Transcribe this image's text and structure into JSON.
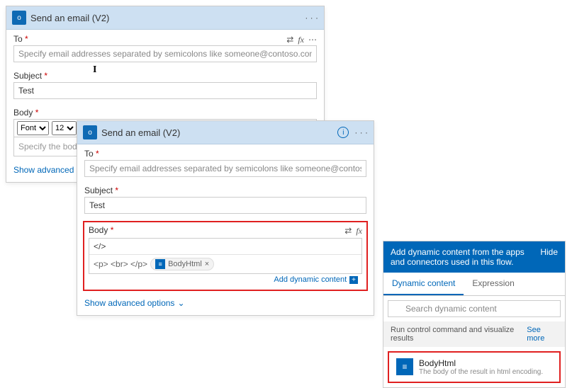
{
  "card1": {
    "title": "Send an email (V2)",
    "to_label": "To",
    "to_placeholder": "Specify email addresses separated by semicolons like someone@contoso.com",
    "subject_label": "Subject",
    "subject_value": "Test",
    "body_label": "Body",
    "font_button": "Font",
    "font_size": "12",
    "body_placeholder": "Specify the body of the",
    "advanced": "Show advanced options"
  },
  "card2": {
    "title": "Send an email (V2)",
    "to_label": "To",
    "to_placeholder": "Specify email addresses separated by semicolons like someone@contoso.com",
    "subject_label": "Subject",
    "subject_value": "Test",
    "body_label": "Body",
    "body_tagpreview": "</>",
    "body_tokens_prefix": "<p> <br> </p>",
    "body_token": "BodyHtml",
    "add_dc": "Add dynamic content",
    "advanced": "Show advanced options"
  },
  "dc": {
    "head_text": "Add dynamic content from the apps and connectors used in this flow.",
    "hide": "Hide",
    "tab1": "Dynamic content",
    "tab2": "Expression",
    "search_placeholder": "Search dynamic content",
    "group_title": "Run control command and visualize results",
    "see_more": "See more",
    "item_title": "BodyHtml",
    "item_desc": "The body of the result in html encoding."
  }
}
